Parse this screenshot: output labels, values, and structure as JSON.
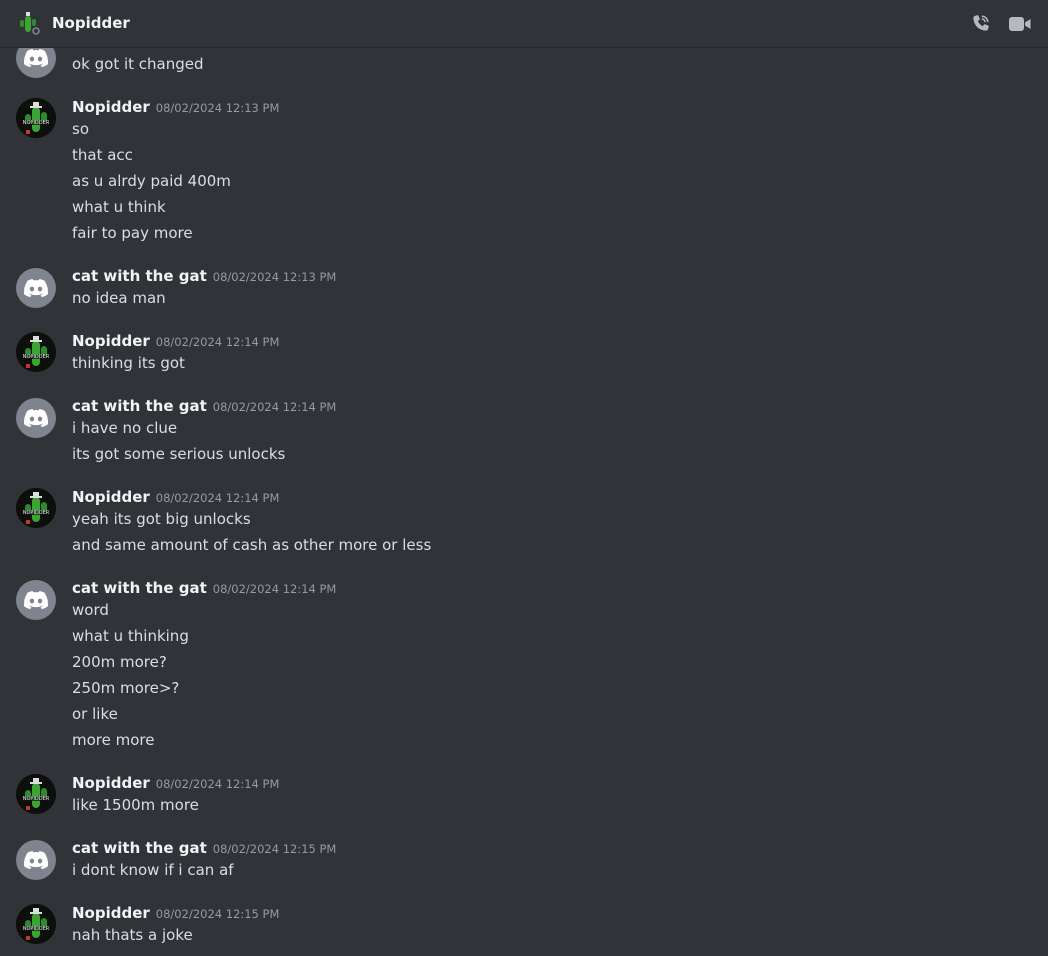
{
  "header": {
    "title": "Nopidder",
    "call_icon": "phone-call-icon",
    "video_icon": "video-camera-icon"
  },
  "colors": {
    "background": "#313338",
    "header_text": "#f2f3f5",
    "timestamp": "#949ba4",
    "discord_avatar_bg": "#80848e",
    "nopidder_green": "#3ba534"
  },
  "messages": [
    {
      "author": "",
      "time": "",
      "lines": [
        "ok got it changed"
      ]
    },
    {
      "author": "Nopidder",
      "time": "08/02/2024 12:13 PM",
      "lines": [
        "so",
        "that acc",
        "as u alrdy paid 400m",
        "what u think",
        "fair to pay more"
      ]
    },
    {
      "author": "cat with the gat",
      "time": "08/02/2024 12:13 PM",
      "lines": [
        "no idea man"
      ]
    },
    {
      "author": "Nopidder",
      "time": "08/02/2024 12:14 PM",
      "lines": [
        "thinking its got"
      ]
    },
    {
      "author": "cat with the gat",
      "time": "08/02/2024 12:14 PM",
      "lines": [
        "i have no clue",
        "its got some serious unlocks"
      ]
    },
    {
      "author": "Nopidder",
      "time": "08/02/2024 12:14 PM",
      "lines": [
        "yeah its got big unlocks",
        "and same amount of cash as other more or less"
      ]
    },
    {
      "author": "cat with the gat",
      "time": "08/02/2024 12:14 PM",
      "lines": [
        "word",
        "what u thinking",
        "200m more?",
        "250m more>?",
        "or like",
        "more more"
      ]
    },
    {
      "author": "Nopidder",
      "time": "08/02/2024 12:14 PM",
      "lines": [
        "like 1500m more"
      ]
    },
    {
      "author": "cat with the gat",
      "time": "08/02/2024 12:15 PM",
      "lines": [
        "i dont know if i can af"
      ]
    },
    {
      "author": "Nopidder",
      "time": "08/02/2024 12:15 PM",
      "lines": [
        "nah thats a joke"
      ]
    }
  ]
}
